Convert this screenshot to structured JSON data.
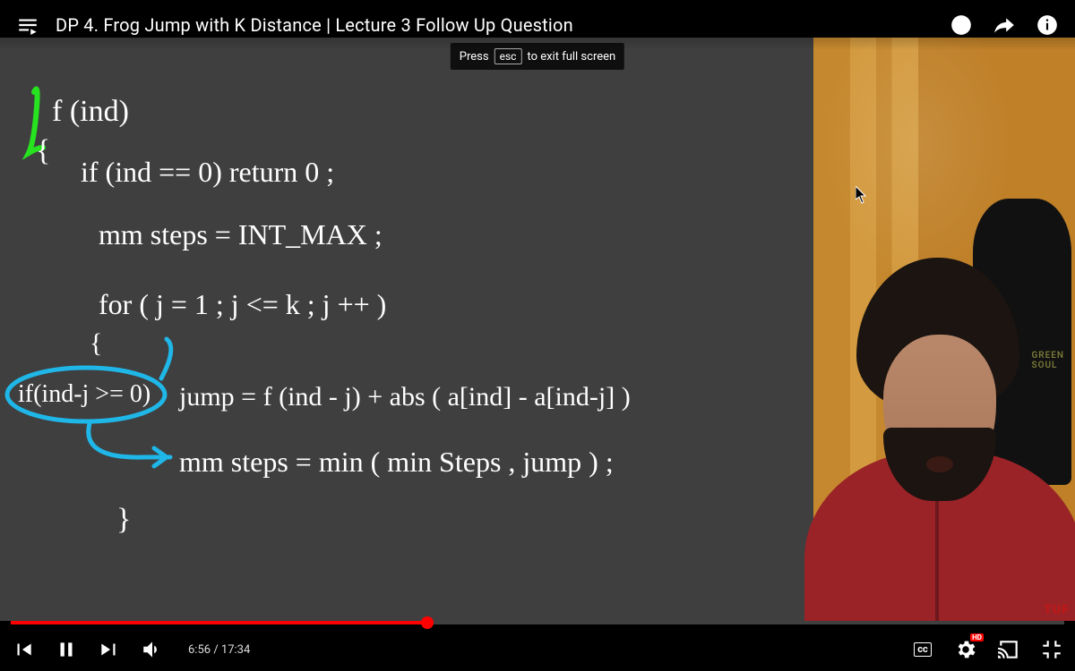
{
  "top": {
    "title": "DP 4. Frog Jump with K Distance | Lecture 3 Follow Up Question"
  },
  "hint": {
    "pre": "Press",
    "key": "esc",
    "post": "to exit full screen"
  },
  "board": {
    "line1": "f (ind)",
    "line2": "{",
    "line3": "if (ind == 0) return 0 ;",
    "line4": "mm steps = INT_MAX ;",
    "line5": "for ( j = 1 ; j <= k ; j ++ )",
    "line6": "{",
    "cond": "if(ind-j >= 0)",
    "line7": "jump = f (ind - j) + abs ( a[ind] - a[ind-j] )",
    "line8": "mm steps = min ( min Steps , jump ) ;",
    "line9": "}"
  },
  "camera": {
    "chair_brand": "GREEN SOUL",
    "watermark": "TUF"
  },
  "player": {
    "current": "6:56",
    "duration": "17:34",
    "progress_pct": 39.5,
    "cc_label": "cc",
    "hd_label": "HD"
  }
}
